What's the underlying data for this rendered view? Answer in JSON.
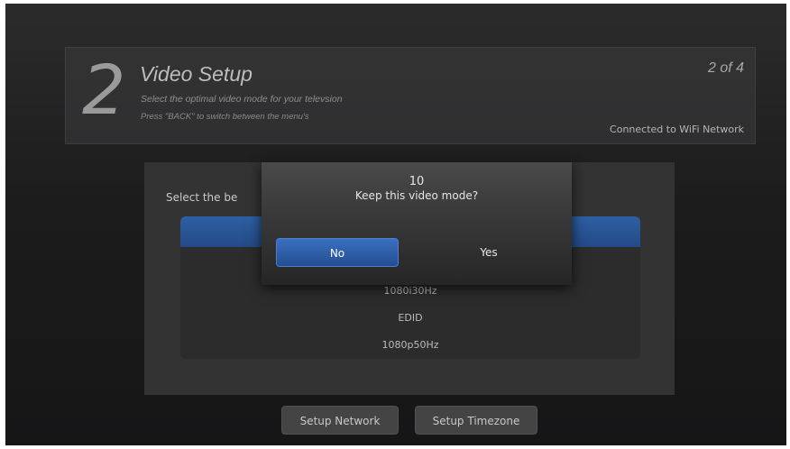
{
  "header": {
    "step_number": "2",
    "title": "Video Setup",
    "subtitle": "Select the optimal video mode for your televsion",
    "hint": "Press \"BACK\" to switch between the menu's",
    "step_counter": "2 of 4",
    "connection_status": "Connected to WiFi Network"
  },
  "main": {
    "select_label": "Select the be",
    "modes": [
      "1080i30Hz",
      "EDID",
      "1080p50Hz"
    ]
  },
  "dialog": {
    "countdown": "10",
    "question": "Keep this video mode?",
    "no_label": "No",
    "yes_label": "Yes"
  },
  "footer": {
    "setup_network_label": "Setup Network",
    "setup_timezone_label": "Setup Timezone"
  },
  "colors": {
    "accent": "#2e5fa4",
    "background": "#1c1c1d"
  }
}
